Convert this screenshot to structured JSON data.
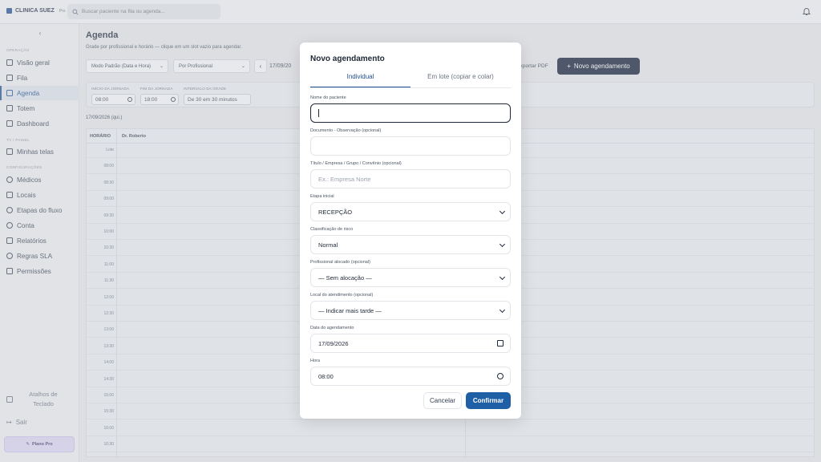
{
  "brand": {
    "name": "CLINICA SUEZ",
    "tier": "Pro"
  },
  "search": {
    "placeholder": "Buscar paciente na fila ou agenda..."
  },
  "sidebar": {
    "sections": [
      "OPERAÇÃO",
      "TV / PAINEL",
      "CONFIGURAÇÕES"
    ],
    "items": [
      {
        "label": "Visão geral",
        "icon": "grid-icon"
      },
      {
        "label": "Fila",
        "icon": "list-icon"
      },
      {
        "label": "Agenda",
        "icon": "calendar-icon",
        "active": true
      },
      {
        "label": "Totem",
        "icon": "kiosk-icon"
      },
      {
        "label": "Dashboard",
        "icon": "dashboard-icon"
      },
      {
        "label": "Minhas telas",
        "icon": "monitor-icon"
      },
      {
        "label": "Médicos",
        "icon": "doctor-icon"
      },
      {
        "label": "Locais",
        "icon": "location-icon"
      },
      {
        "label": "Etapas do fluxo",
        "icon": "flow-icon"
      },
      {
        "label": "Conta",
        "icon": "gear-icon"
      },
      {
        "label": "Relatórios",
        "icon": "chart-icon"
      },
      {
        "label": "Regras SLA",
        "icon": "sla-icon"
      },
      {
        "label": "Permissões",
        "icon": "permissions-icon"
      }
    ],
    "shortcuts_label": "Atalhos de Teclado",
    "logout_label": "Sair",
    "plan_label": "Plano Pro"
  },
  "main": {
    "title": "Agenda",
    "subtitle": "Grade por profissional e horário — clique em um slot vazio para agendar.",
    "mode_select": "Modo Padrão (Data e Hora)",
    "group_select": "Por Profissional",
    "date_display": "17/09/20",
    "export_pdf": "Exportar PDF",
    "new_appointment": "Novo agendamento",
    "filters": {
      "start_label": "INÍCIO DA JORNADA",
      "start_value": "08:00",
      "end_label": "FIM DA JORNADA",
      "end_value": "18:00",
      "interval_label": "INTERVALO DA GRADE",
      "interval_value": "De 30 em 30 minutos"
    },
    "day_label": "17/09/2026 (qui.)",
    "grid": {
      "time_header": "HORÁRIO",
      "professional": "Dr. Roberto",
      "times": [
        "Lote",
        "08:00",
        "08:30",
        "09:00",
        "09:30",
        "10:00",
        "10:30",
        "11:00",
        "11:30",
        "12:00",
        "12:30",
        "13:00",
        "13:30",
        "14:00",
        "14:30",
        "15:00",
        "15:30",
        "16:00",
        "16:30"
      ]
    }
  },
  "modal": {
    "title": "Novo agendamento",
    "tabs": [
      "Individual",
      "Em lote (copiar e colar)"
    ],
    "fields": {
      "patient_label": "Nome do paciente",
      "patient_value": "",
      "document_label": "Documento - Observação (opcional)",
      "document_value": "",
      "title_label": "Título / Empresa / Grupo / Convênio (opcional)",
      "title_placeholder": "Ex.: Empresa Norte",
      "stage_label": "Etapa inicial",
      "stage_value": "RECEPÇÃO",
      "risk_label": "Classificação de risco",
      "risk_value": "Normal",
      "professional_label": "Profissional alocado (opcional)",
      "professional_value": "— Sem alocação —",
      "location_label": "Local do atendimento (opcional)",
      "location_value": "— Indicar mais tarde —",
      "date_label": "Data do agendamento",
      "date_value": "17/09/2026",
      "time_label": "Hora",
      "time_value": "08:00"
    },
    "cancel": "Cancelar",
    "confirm": "Confirmar"
  }
}
